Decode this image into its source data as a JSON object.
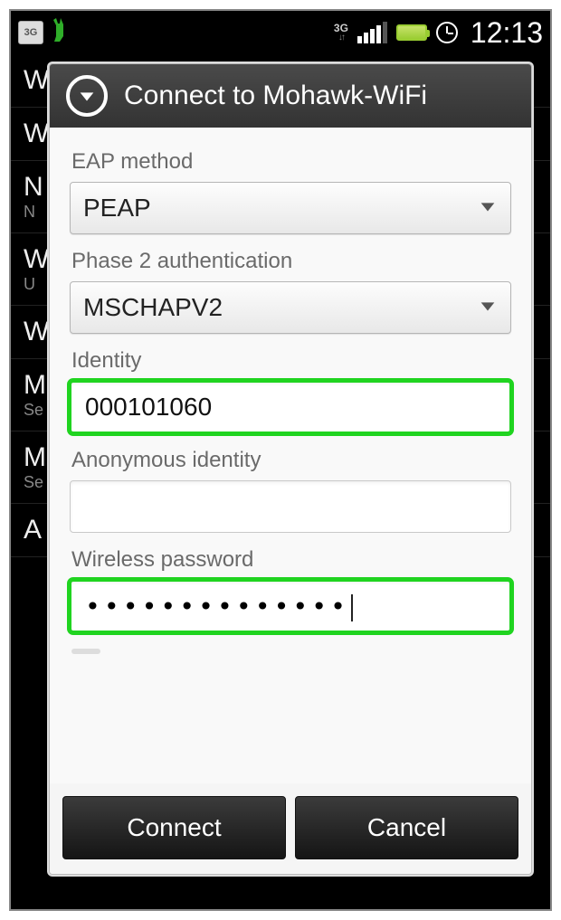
{
  "status": {
    "left_3g_label": "3G",
    "data_label": "3G",
    "time": "12:13"
  },
  "dialog": {
    "title": "Connect to Mohawk-WiFi",
    "labels": {
      "eap": "EAP method",
      "phase2": "Phase 2 authentication",
      "identity": "Identity",
      "anon": "Anonymous identity",
      "password": "Wireless password"
    },
    "values": {
      "eap": "PEAP",
      "phase2": "MSCHAPV2",
      "identity": "000101060",
      "anon": "",
      "password_mask": "••••••••••••••"
    },
    "buttons": {
      "connect": "Connect",
      "cancel": "Cancel"
    }
  },
  "bg": {
    "rows": [
      {
        "t": "Wi",
        "s": ""
      },
      {
        "t": "W",
        "s": ""
      },
      {
        "t": "N",
        "s": "N"
      },
      {
        "t": "W",
        "s": "U"
      },
      {
        "t": "Wi",
        "s": ""
      },
      {
        "t": "M",
        "s": "Se"
      },
      {
        "t": "M",
        "s": "Se"
      },
      {
        "t": "A",
        "s": ""
      }
    ]
  }
}
